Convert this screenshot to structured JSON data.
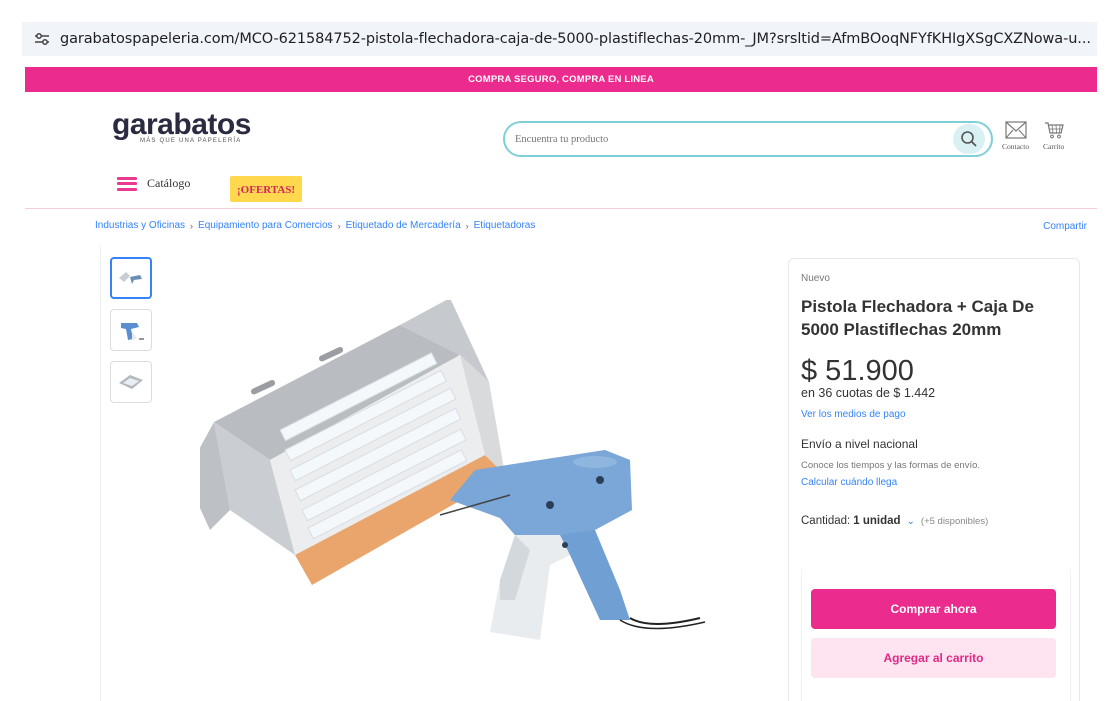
{
  "browser": {
    "url": "garabatospapeleria.com/MCO-621584752-pistola-flechadora-caja-de-5000-plastiflechas-20mm-_JM?srsltid=AfmBOoqNFYfKHIgXSgCXZNowa-u..."
  },
  "promo": {
    "text": "COMPRA SEGURO, COMPRA EN LINEA"
  },
  "header": {
    "logo_text": "garabatos",
    "logo_tagline": "MÁS QUE UNA PAPELERÍA",
    "search_placeholder": "Encuentra tu producto",
    "contact_label": "Contacto",
    "cart_label": "Carrito",
    "catalog_label": "Catálogo",
    "offers_label": "¡OFERTAS!"
  },
  "breadcrumb": [
    "Industrias y Oficinas",
    "Equipamiento para Comercios",
    "Etiquetado de Mercadería",
    "Etiquetadoras"
  ],
  "share_label": "Compartir",
  "product": {
    "condition": "Nuevo",
    "title": "Pistola Flechadora + Caja De 5000 Plastiflechas 20mm",
    "price": "$ 51.900",
    "installments": "en 36 cuotas de $ 1.442",
    "payment_link": "Ver los medios de pago",
    "shipping_title": "Envío a nivel nacional",
    "shipping_sub": "Conoce los tiempos y las formas de envío.",
    "shipping_link": "Calcular cuándo llega",
    "quantity_label": "Cantidad:",
    "quantity_value": "1 unidad",
    "available": "(+5 disponibles)",
    "buy_button": "Comprar ahora",
    "cart_button": "Agregar al carrito"
  },
  "thumbnails": [
    "tag-pins-thumbnail",
    "tag-gun-thumbnail",
    "tag-box-thumbnail"
  ],
  "colors": {
    "brand_pink": "#ec2b8e",
    "link_blue": "#3483fa",
    "offer_yellow": "#ffd84d",
    "search_border": "#7fd0d6"
  }
}
